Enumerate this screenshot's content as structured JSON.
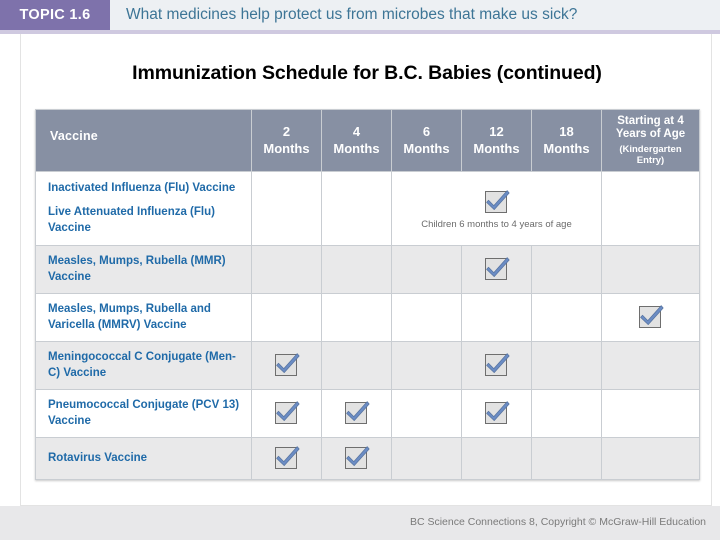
{
  "topbar": {
    "badge": "TOPIC 1.6",
    "question": "What medicines help protect us from microbes that make us sick?",
    "badge_color": "#7e72ab",
    "question_color": "#3d7596"
  },
  "slide": {
    "title": "Immunization Schedule for B.C. Babies (continued)"
  },
  "table": {
    "header_color": "#8790a3",
    "vaccine_text_color": "#1f6aa8",
    "check_color": "#6b8cc4",
    "columns": [
      {
        "label": "Vaccine",
        "sub": ""
      },
      {
        "label": "2",
        "sub": "Months"
      },
      {
        "label": "4",
        "sub": "Months"
      },
      {
        "label": "6",
        "sub": "Months"
      },
      {
        "label": "12",
        "sub": "Months"
      },
      {
        "label": "18",
        "sub": "Months"
      },
      {
        "label": "Starting at 4 Years of Age",
        "sub": "(Kindergarten Entry)"
      }
    ],
    "rows": [
      {
        "vaccine_lines": [
          "Inactivated Influenza (Flu) Vaccine",
          "Live Attenuated Influenza (Flu) Vaccine"
        ],
        "marks": [
          false,
          false,
          true,
          false,
          false,
          false
        ],
        "note_col": 3,
        "note": "Children 6 months to 4 years of age"
      },
      {
        "vaccine_lines": [
          "Measles, Mumps, Rubella (MMR) Vaccine"
        ],
        "marks": [
          false,
          false,
          false,
          true,
          false,
          false
        ],
        "note_col": null,
        "note": ""
      },
      {
        "vaccine_lines": [
          "Measles, Mumps, Rubella and Varicella (MMRV) Vaccine"
        ],
        "marks": [
          false,
          false,
          false,
          false,
          false,
          true
        ],
        "note_col": null,
        "note": ""
      },
      {
        "vaccine_lines": [
          "Meningococcal C Conjugate (Men-C) Vaccine"
        ],
        "marks": [
          true,
          false,
          false,
          true,
          false,
          false
        ],
        "note_col": null,
        "note": ""
      },
      {
        "vaccine_lines": [
          "Pneumococcal Conjugate (PCV 13) Vaccine"
        ],
        "marks": [
          true,
          true,
          false,
          true,
          false,
          false
        ],
        "note_col": null,
        "note": ""
      },
      {
        "vaccine_lines": [
          "Rotavirus Vaccine"
        ],
        "marks": [
          true,
          true,
          false,
          false,
          false,
          false
        ],
        "note_col": null,
        "note": ""
      }
    ]
  },
  "footer": {
    "text": "BC Science Connections 8, Copyright © McGraw-Hill Education"
  }
}
